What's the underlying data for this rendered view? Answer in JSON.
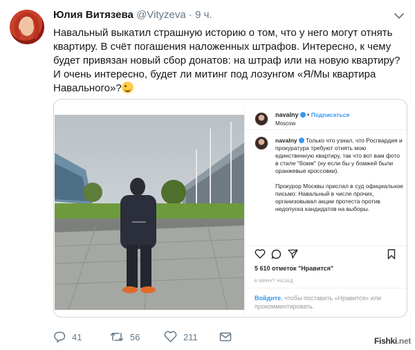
{
  "tweet": {
    "author_name": "Юлия Витязева",
    "author_handle": "@Vityzeva",
    "separator": "·",
    "time": "9 ч.",
    "text": "Навальный выкатил страшную историю о том, что у него могут отнять квартиру. В счёт погашения наложенных штрафов. Интересно, к чему будет привязан новый сбор донатов: на штраф или на новую квартиру?\nИ очень интересно, будет ли митинг под лозунгом «Я/Мы квартира Навального»?",
    "emoji_icon": "winking-face-emoji",
    "counts": {
      "replies": "41",
      "retweets": "56",
      "likes": "211"
    }
  },
  "instagram": {
    "username": "navalny",
    "follow_separator": "•",
    "follow_label": "Подписаться",
    "location": "Moscow",
    "caption_user": "navalny",
    "caption_p1": " Только что узнал, что Росгвардия и прокуратура требуют отнять мою единственную квартиру, так что вот вам фото в стиле \"бомж\" (ну если бы у бомжей были оранжевые кроссовки).",
    "caption_p2": "Прокурор Москвы прислал в суд официальное письмо: Навальный в числе прочих, организовывал акции протеста против недопуска кандидатов на выборы.",
    "likes": "5 610 отметок \"Нравится\"",
    "time": "6 МИНУТ НАЗАД",
    "login_link": "Войдите",
    "login_text": ", чтобы поставить «Нравится» или прокомментировать.",
    "colors": {
      "link": "#3897f0",
      "verified": "#3897f0"
    }
  },
  "watermark": {
    "part1": "Fishki",
    "part2": ".net"
  },
  "colors": {
    "muted": "#657786",
    "text": "#14171a",
    "border": "#ccd6dd"
  }
}
